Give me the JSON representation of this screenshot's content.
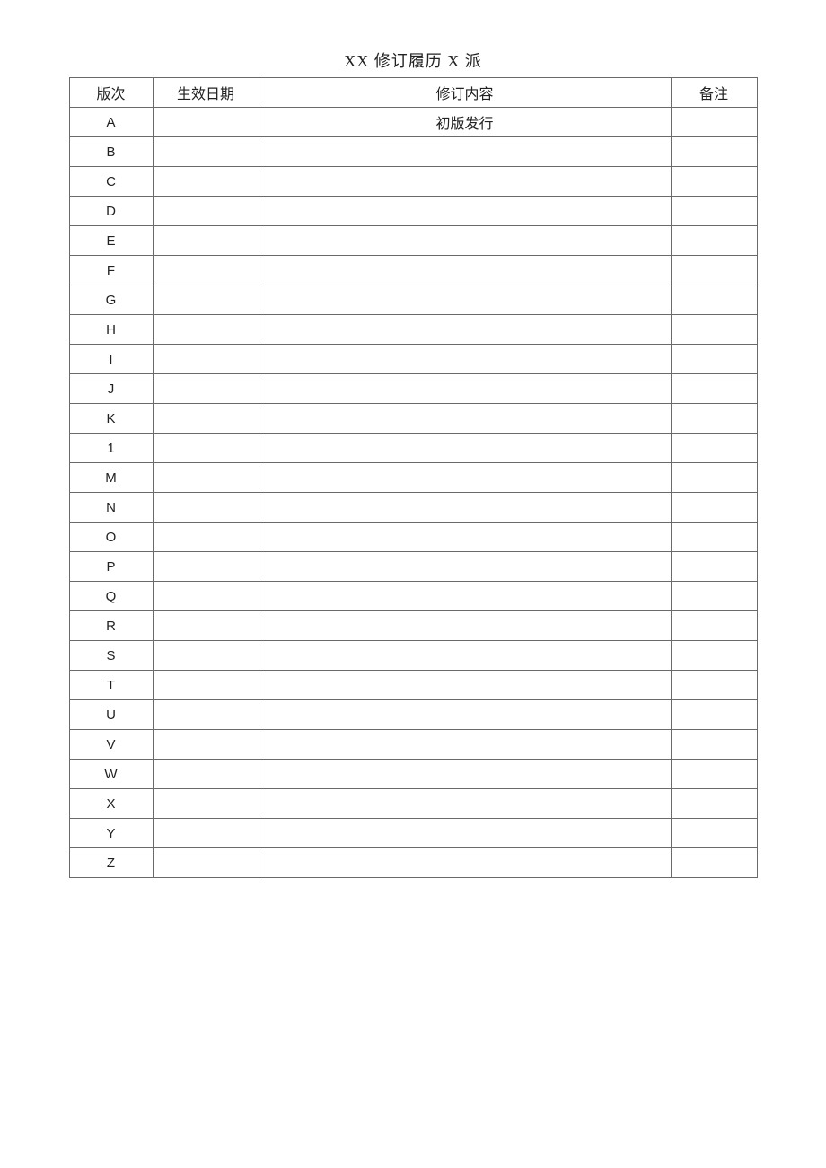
{
  "title": "XX 修订履历 X 派",
  "headers": {
    "version": "版次",
    "effective_date": "生效日期",
    "content": "修订内容",
    "note": "备注"
  },
  "rows": [
    {
      "version": "A",
      "effective_date": "",
      "content": "初版发行",
      "note": ""
    },
    {
      "version": "B",
      "effective_date": "",
      "content": "",
      "note": ""
    },
    {
      "version": "C",
      "effective_date": "",
      "content": "",
      "note": ""
    },
    {
      "version": "D",
      "effective_date": "",
      "content": "",
      "note": ""
    },
    {
      "version": "E",
      "effective_date": "",
      "content": "",
      "note": ""
    },
    {
      "version": "F",
      "effective_date": "",
      "content": "",
      "note": ""
    },
    {
      "version": "G",
      "effective_date": "",
      "content": "",
      "note": ""
    },
    {
      "version": "H",
      "effective_date": "",
      "content": "",
      "note": ""
    },
    {
      "version": "I",
      "effective_date": "",
      "content": "",
      "note": ""
    },
    {
      "version": "J",
      "effective_date": "",
      "content": "",
      "note": ""
    },
    {
      "version": "K",
      "effective_date": "",
      "content": "",
      "note": ""
    },
    {
      "version": "1",
      "effective_date": "",
      "content": "",
      "note": ""
    },
    {
      "version": "M",
      "effective_date": "",
      "content": "",
      "note": ""
    },
    {
      "version": "N",
      "effective_date": "",
      "content": "",
      "note": ""
    },
    {
      "version": "O",
      "effective_date": "",
      "content": "",
      "note": ""
    },
    {
      "version": "P",
      "effective_date": "",
      "content": "",
      "note": ""
    },
    {
      "version": "Q",
      "effective_date": "",
      "content": "",
      "note": ""
    },
    {
      "version": "R",
      "effective_date": "",
      "content": "",
      "note": ""
    },
    {
      "version": "S",
      "effective_date": "",
      "content": "",
      "note": ""
    },
    {
      "version": "T",
      "effective_date": "",
      "content": "",
      "note": ""
    },
    {
      "version": "U",
      "effective_date": "",
      "content": "",
      "note": ""
    },
    {
      "version": "V",
      "effective_date": "",
      "content": "",
      "note": ""
    },
    {
      "version": "W",
      "effective_date": "",
      "content": "",
      "note": ""
    },
    {
      "version": "X",
      "effective_date": "",
      "content": "",
      "note": ""
    },
    {
      "version": "Y",
      "effective_date": "",
      "content": "",
      "note": ""
    },
    {
      "version": "Z",
      "effective_date": "",
      "content": "",
      "note": ""
    }
  ]
}
